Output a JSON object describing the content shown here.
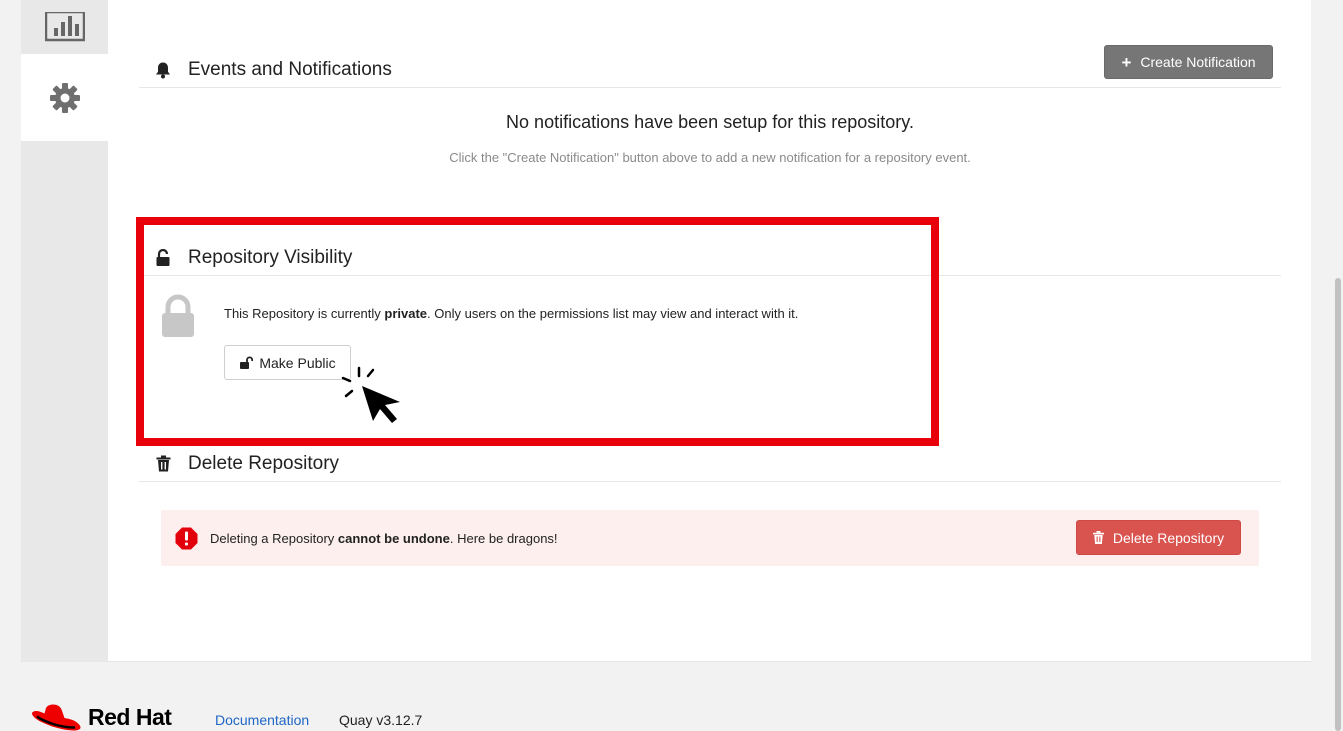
{
  "tabs": {
    "usage_icon": "bar-chart-icon",
    "settings_icon": "gear-icon"
  },
  "events": {
    "title": "Events and Notifications",
    "create_button": "Create Notification",
    "empty_title": "No notifications have been setup for this repository.",
    "empty_subtitle": "Click the \"Create Notification\" button above to add a new notification for a repository event."
  },
  "visibility": {
    "title": "Repository Visibility",
    "text_before": "This Repository is currently ",
    "status": "private",
    "text_after": ". Only users on the permissions list may view and interact with it.",
    "make_public_button": "Make Public"
  },
  "delete": {
    "title": "Delete Repository",
    "text_before": "Deleting a Repository ",
    "emphasis": "cannot be undone",
    "text_after": ". Here be dragons!",
    "button": "Delete Repository"
  },
  "footer": {
    "brand": "Red Hat",
    "doc_link": "Documentation",
    "version": "Quay v3.12.7"
  },
  "colors": {
    "highlight": "#e8000b",
    "danger": "#d9534f",
    "alert_bg": "#fcefee",
    "link": "#1f66c6"
  }
}
